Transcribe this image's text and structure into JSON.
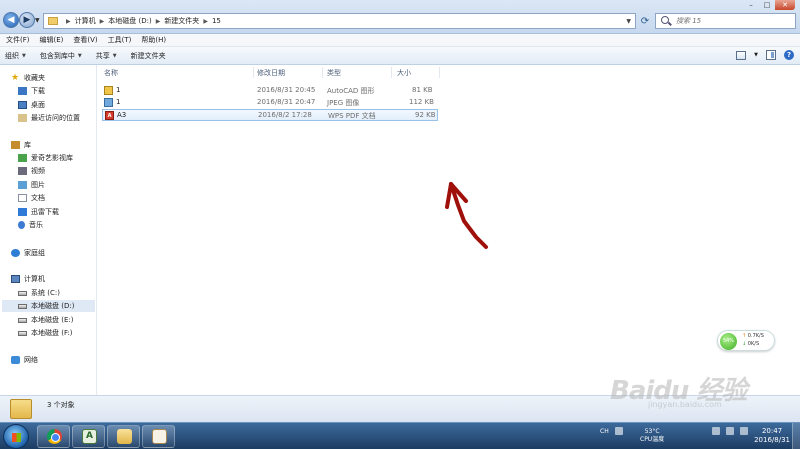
{
  "window": {
    "breadcrumb": [
      "计算机",
      "本地磁盘 (D:)",
      "新建文件夹",
      "15"
    ],
    "search_placeholder": "搜索 15"
  },
  "menu": [
    "文件(F)",
    "编辑(E)",
    "查看(V)",
    "工具(T)",
    "帮助(H)"
  ],
  "toolbar": {
    "organize": "组织",
    "include_library": "包含到库中",
    "share": "共享",
    "new_folder": "新建文件夹"
  },
  "sidebar": {
    "favorites": "收藏夹",
    "fav_items": [
      "下载",
      "桌面",
      "最近访问的位置"
    ],
    "libraries": "库",
    "lib_items": [
      "爱奇艺影视库",
      "视频",
      "图片",
      "文档",
      "迅雷下载",
      "音乐"
    ],
    "homegroup": "家庭组",
    "computer": "计算机",
    "drives": [
      "系统 (C:)",
      "本地磁盘 (D:)",
      "本地磁盘 (E:)",
      "本地磁盘 (F:)"
    ],
    "network": "网络"
  },
  "columns": {
    "name": "名称",
    "modified": "修改日期",
    "type": "类型",
    "size": "大小"
  },
  "files": [
    {
      "name": "1",
      "modified": "2016/8/31 20:45",
      "type": "AutoCAD 图形",
      "size": "81 KB",
      "icon": "dwg-icon"
    },
    {
      "name": "1",
      "modified": "2016/8/31 20:47",
      "type": "JPEG 图像",
      "size": "112 KB",
      "icon": "jpg-icon"
    },
    {
      "name": "A3",
      "modified": "2016/8/2 17:28",
      "type": "WPS PDF 文档",
      "size": "92 KB",
      "icon": "pdf-icon"
    }
  ],
  "status": {
    "count": "3 个对象"
  },
  "taskbar": {
    "temp_value": "53°C",
    "temp_label": "CPU温度",
    "ime": "CH",
    "time": "20:47",
    "date": "2016/8/31"
  },
  "net_widget": {
    "percent": "54%",
    "up": "0.7K/S",
    "down": "0K/S"
  },
  "watermark": {
    "main": "Baidu 经验",
    "sub": "jingyan.baidu.com"
  },
  "colors": {
    "selection": "#dfe8f5",
    "annotation_arrow": "#a0100b"
  }
}
